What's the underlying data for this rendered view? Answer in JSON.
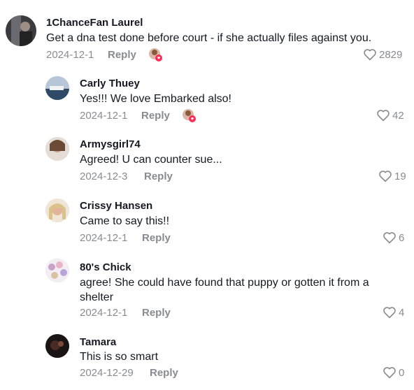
{
  "comments": [
    {
      "username": "1ChanceFan Laurel",
      "text": "Get a dna test done before court - if she actually files against you.",
      "date": "2024-12-1",
      "reply_label": "Reply",
      "likes": "2829",
      "liked_by_creator": true
    },
    {
      "username": "Carly Thuey",
      "text": "Yes!!! We love Embarked also!",
      "date": "2024-12-1",
      "reply_label": "Reply",
      "likes": "42",
      "liked_by_creator": true
    },
    {
      "username": "Armysgirl74",
      "text": "Agreed! U can counter sue...",
      "date": "2024-12-3",
      "reply_label": "Reply",
      "likes": "19",
      "liked_by_creator": false
    },
    {
      "username": "Crissy Hansen",
      "text": "Came to say this!!",
      "date": "2024-12-1",
      "reply_label": "Reply",
      "likes": "6",
      "liked_by_creator": false
    },
    {
      "username": "80's Chick",
      "text": "agree! She could have found that puppy or gotten it from a shelter",
      "date": "2024-12-1",
      "reply_label": "Reply",
      "likes": "4",
      "liked_by_creator": false
    },
    {
      "username": "Tamara",
      "text": "This is so smart",
      "date": "2024-12-29",
      "reply_label": "Reply",
      "likes": "0",
      "liked_by_creator": false
    }
  ],
  "icons": {
    "like": "heart-outline-icon",
    "creator_liked": "creator-liked-avatar-icon"
  },
  "colors": {
    "text": "#161823",
    "muted": "#8a8b91",
    "heart_badge": "#fe2c55"
  }
}
